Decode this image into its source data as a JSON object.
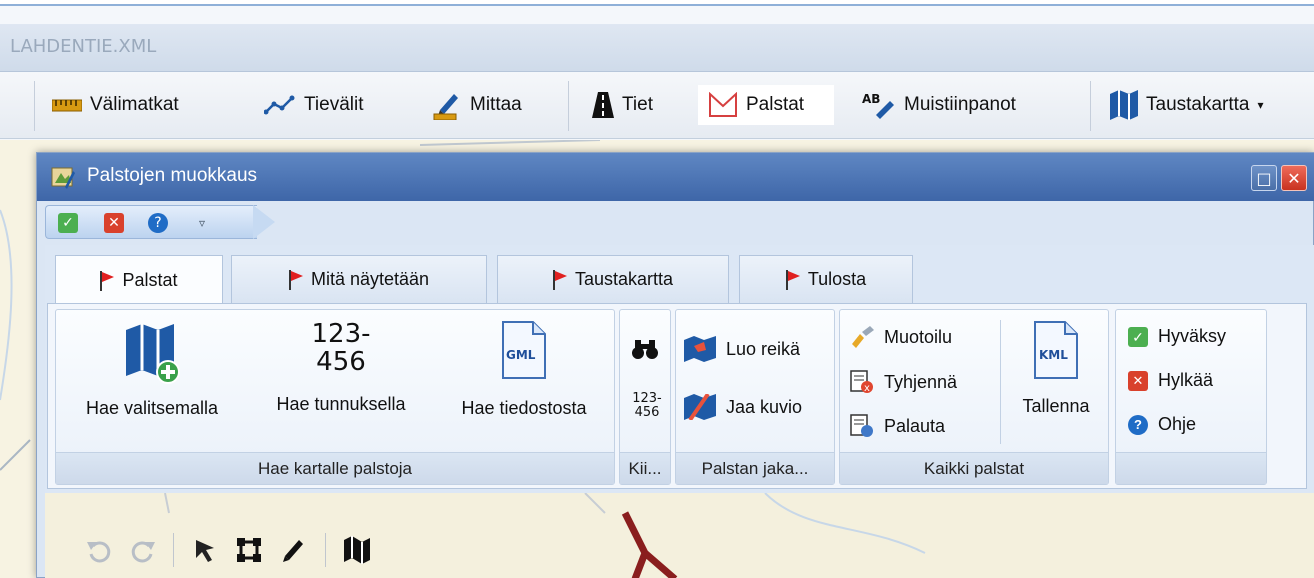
{
  "app": {
    "title": "LAHDENTIE.XML"
  },
  "toolbar": {
    "items": [
      {
        "label": "Välimatkat",
        "icon": "ruler-icon"
      },
      {
        "label": "Tievälit",
        "icon": "route-line-icon"
      },
      {
        "label": "Mittaa",
        "icon": "measure-pen-icon"
      },
      {
        "label": "Tiet",
        "icon": "road-icon"
      },
      {
        "label": "Palstat",
        "icon": "parcel-icon"
      },
      {
        "label": "Muistiinpanot",
        "icon": "note-ab-icon"
      },
      {
        "label": "Taustakartta",
        "icon": "map-icon"
      }
    ],
    "active": "Palstat"
  },
  "dialog": {
    "title": "Palstojen muokkaus",
    "tabs": [
      "Palstat",
      "Mitä näytetään",
      "Taustakartta",
      "Tulosta"
    ],
    "active_tab": "Palstat",
    "groups": {
      "hae": {
        "label": "Hae kartalle palstoja",
        "buttons": [
          "Hae valitsemalla",
          "Hae tunnuksella",
          "Hae tiedostosta"
        ],
        "code_icon_text": [
          "123-",
          "456"
        ],
        "file_icon_text": "GML"
      },
      "kii": {
        "label": "Kii...",
        "small_code": [
          "123-",
          "456"
        ]
      },
      "jako": {
        "label": "Palstan jaka...",
        "buttons": [
          "Luo reikä",
          "Jaa kuvio"
        ]
      },
      "kaikki": {
        "label": "Kaikki palstat",
        "buttons": [
          "Muotoilu",
          "Tyhjennä",
          "Palauta"
        ],
        "save_label": "Tallenna",
        "file_icon_text": "KML"
      },
      "actions": {
        "buttons": [
          "Hyväksy",
          "Hylkää",
          "Ohje"
        ]
      }
    }
  },
  "colors": {
    "accent": "#3e66a8",
    "flag": "#e02020",
    "map_icon": "#1f5aa6",
    "road": "#8a1e1e"
  }
}
